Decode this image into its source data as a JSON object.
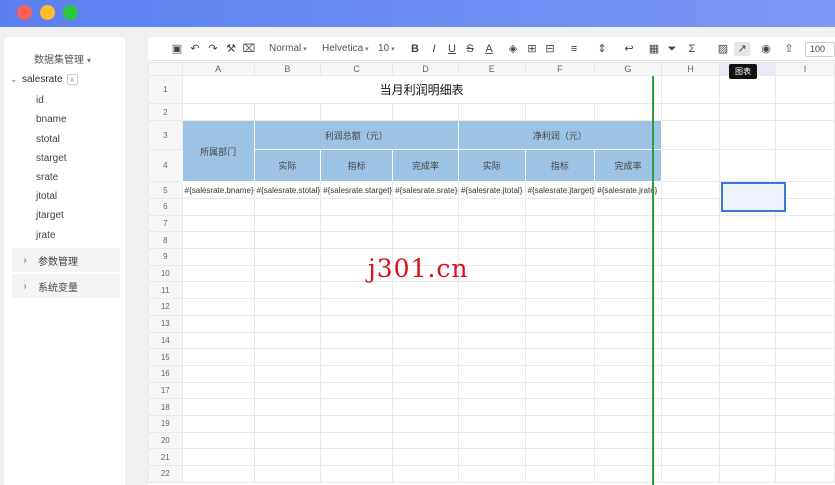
{
  "sidebar": {
    "title": "数据集管理",
    "dataset": {
      "name": "salesrate",
      "remove": "x"
    },
    "fields": [
      "id",
      "bname",
      "stotal",
      "starget",
      "srate",
      "jtotal",
      "jtarget",
      "jrate"
    ],
    "panels": [
      "参数管理",
      "系统变量"
    ]
  },
  "toolbar": {
    "style": "Normal",
    "font": "Helvetica",
    "size": "10",
    "zoom": "100",
    "tooltip": "图表"
  },
  "sheet": {
    "columns": [
      "A",
      "B",
      "C",
      "D",
      "E",
      "F",
      "G",
      "H",
      "",
      "I"
    ],
    "rows": [
      "1",
      "2",
      "3",
      "4",
      "5",
      "6",
      "7",
      "8",
      "9",
      "10",
      "11",
      "12",
      "13",
      "14",
      "15",
      "16",
      "17",
      "18",
      "19",
      "20",
      "21",
      "22"
    ],
    "title": "当月利润明细表",
    "dept_header": "所属部门",
    "group1": "利润总额（元）",
    "group2": "净利润（元）",
    "sub_actual": "实际",
    "sub_target": "指标",
    "sub_rate": "完成率",
    "cells": [
      "#{salesrate.bname}",
      "#{salesrate.stotal}",
      "#{salesrate.starget}",
      "#{salesrate.srate}",
      "#{salesrate.jtotal}",
      "#{salesrate.jtarget}",
      "#{salesrate.jrate}"
    ]
  },
  "watermark": "j301.cn"
}
